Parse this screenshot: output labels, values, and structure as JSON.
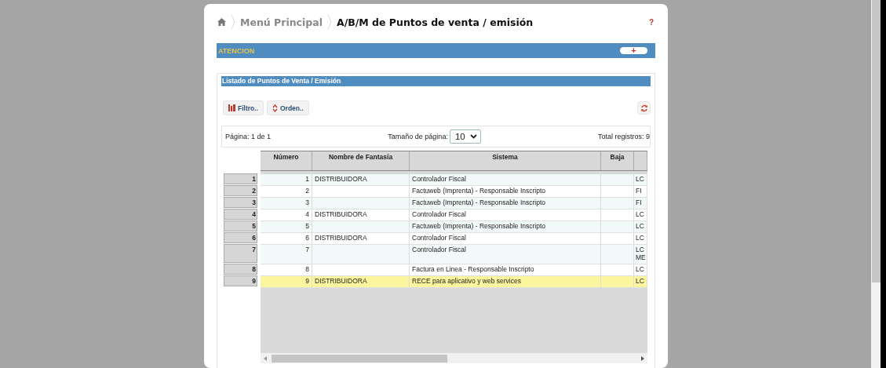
{
  "breadcrumb": {
    "items": [
      "Menú Principal"
    ],
    "current": "A/B/M de Puntos de venta / emisión",
    "help": "?"
  },
  "notice_bar": {
    "title": "ATENCION",
    "toggle": "+"
  },
  "panel": {
    "title": "Listado de Puntos de Venta / Emisión",
    "toolbar": [
      {
        "kind": "filter",
        "label": "Filtro.."
      },
      {
        "kind": "sort",
        "label": "Orden.."
      }
    ],
    "pager": {
      "page": "Página: 1 de 1",
      "size_label": "Tamaño de página:",
      "size": "10",
      "total": "Total registros: 9"
    },
    "table": {
      "columns": [
        "Número",
        "Nombre de Fantasía",
        "Sistema",
        "Baja",
        ""
      ],
      "rows": [
        {
          "index": "1",
          "cells": [
            "1",
            "DISTRIBUIDORA",
            "Controlador Fiscal",
            "",
            "LC"
          ],
          "selected": false
        },
        {
          "index": "2",
          "cells": [
            "2",
            "",
            "Factuweb (Imprenta) - Responsable Inscripto",
            "",
            "FI"
          ],
          "selected": false
        },
        {
          "index": "3",
          "cells": [
            "3",
            "",
            "Factuweb (Imprenta) - Responsable Inscripto",
            "",
            "FI"
          ],
          "selected": false
        },
        {
          "index": "4",
          "cells": [
            "4",
            "DISTRIBUIDORA",
            "Controlador Fiscal",
            "",
            "LC"
          ],
          "selected": false
        },
        {
          "index": "5",
          "cells": [
            "5",
            "",
            "Factuweb (Imprenta) - Responsable Inscripto",
            "",
            "LC"
          ],
          "selected": false
        },
        {
          "index": "6",
          "cells": [
            "6",
            "DISTRIBUIDORA",
            "Controlador Fiscal",
            "",
            "LC"
          ],
          "selected": false
        },
        {
          "index": "7",
          "cells": [
            "7",
            "",
            "Controlador Fiscal",
            "",
            "LC ME"
          ],
          "selected": false
        },
        {
          "index": "8",
          "cells": [
            "8",
            "",
            "Factura en Linea - Responsable Inscripto",
            "",
            "LC"
          ],
          "selected": false
        },
        {
          "index": "9",
          "cells": [
            "9",
            "DISTRIBUIDORA",
            "RECE para aplicativo y web services",
            "",
            "LC"
          ],
          "selected": true
        }
      ]
    }
  }
}
